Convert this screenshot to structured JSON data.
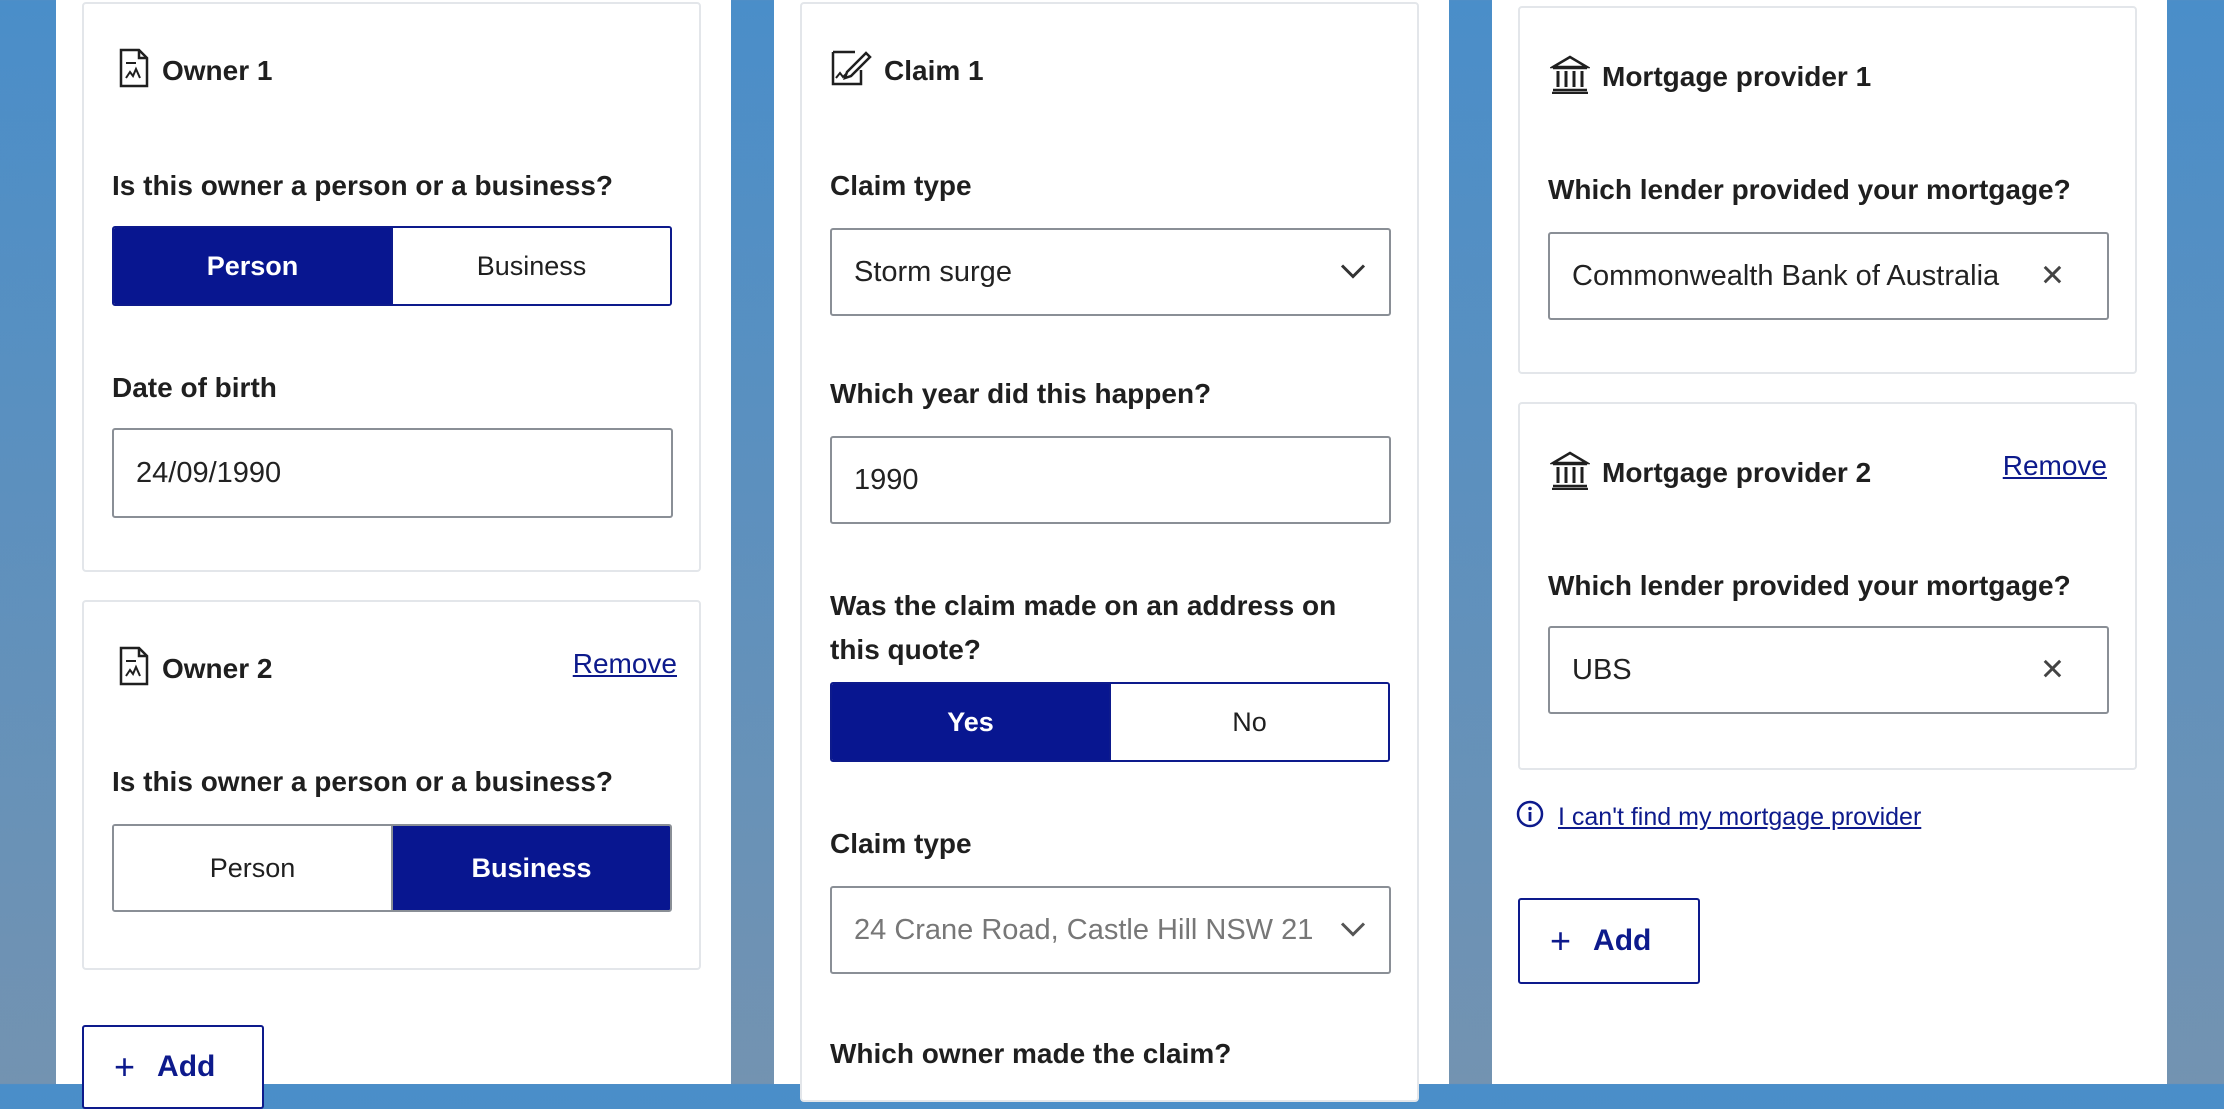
{
  "owners": {
    "owner1": {
      "title": "Owner 1",
      "question": "Is this owner a person or a business?",
      "options": [
        "Person",
        "Business"
      ],
      "selected": "Person",
      "dob_label": "Date of birth",
      "dob_value": "24/09/1990"
    },
    "owner2": {
      "title": "Owner 2",
      "remove_label": "Remove",
      "question": "Is this owner a person or a business?",
      "options": [
        "Person",
        "Business"
      ],
      "selected": "Business"
    },
    "add_label": "Add"
  },
  "claim": {
    "title": "Claim 1",
    "claim_type_label": "Claim type",
    "claim_type_value": "Storm surge",
    "year_label": "Which year did this happen?",
    "year_value": "1990",
    "address_question_line1": "Was the claim made on an address on",
    "address_question_line2": "this quote?",
    "address_options": [
      "Yes",
      "No"
    ],
    "address_selected": "Yes",
    "claim_type2_label": "Claim type",
    "claim_type2_value": "24 Crane Road, Castle Hill NSW 21",
    "owner_question": "Which owner made the claim?"
  },
  "mortgage": {
    "provider1": {
      "title": "Mortgage provider 1",
      "question": "Which lender provided your mortgage?",
      "value": "Commonwealth Bank of Australia"
    },
    "provider2": {
      "title": "Mortgage provider 2",
      "remove_label": "Remove",
      "question": "Which lender provided your mortgage?",
      "value": "UBS"
    },
    "cant_find_label": "I can't find my mortgage provider",
    "add_label": "Add"
  },
  "colors": {
    "primary": "#081690",
    "link": "#0d1a8c",
    "background_top": "#4a8ec9",
    "background_bottom": "#7393b1"
  }
}
